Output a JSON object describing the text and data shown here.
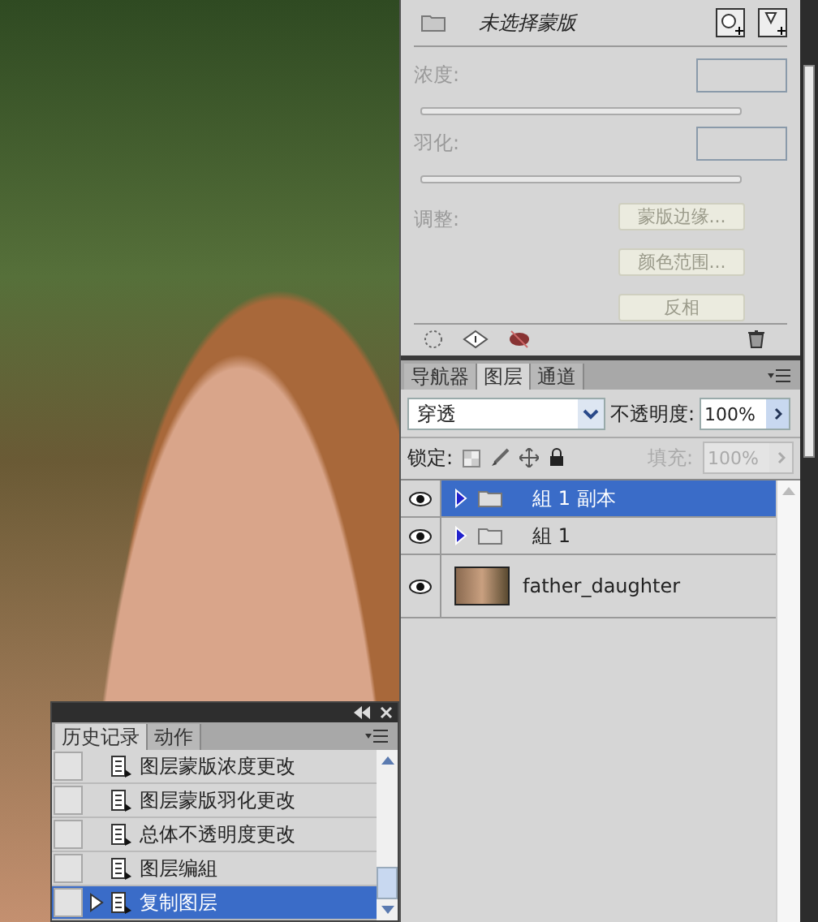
{
  "masks": {
    "title": "未选择蒙版",
    "controls": [
      {
        "label": "浓度:",
        "disabled": true
      },
      {
        "label": "羽化:",
        "disabled": true
      }
    ],
    "adjust_label": "调整:",
    "buttons": [
      "蒙版边缘...",
      "颜色范围...",
      "反相"
    ]
  },
  "layers_panel": {
    "tabs": [
      {
        "label": "导航器",
        "selected": false
      },
      {
        "label": "图层",
        "selected": true
      },
      {
        "label": "通道",
        "selected": false
      }
    ],
    "blend_mode": "穿透",
    "opacity_label": "不透明度:",
    "opacity_value": "100%",
    "lock_label": "锁定:",
    "fill_label": "填充:",
    "fill_value": "100%",
    "layers": [
      {
        "name": "組 1 副本",
        "kind": "group",
        "selected": true,
        "visible": true,
        "expanded": false
      },
      {
        "name": "組 1",
        "kind": "group",
        "selected": false,
        "visible": true,
        "expanded": false
      },
      {
        "name": "father_daughter",
        "kind": "image",
        "selected": false,
        "visible": true
      }
    ]
  },
  "history_panel": {
    "tabs": [
      {
        "label": "历史记录",
        "selected": true
      },
      {
        "label": "动作",
        "selected": false
      }
    ],
    "items": [
      {
        "label": "图层蒙版浓度更改",
        "selected": false
      },
      {
        "label": "图层蒙版羽化更改",
        "selected": false
      },
      {
        "label": "总体不透明度更改",
        "selected": false
      },
      {
        "label": "图层编組",
        "selected": false
      },
      {
        "label": "复制图层",
        "selected": true
      }
    ]
  }
}
